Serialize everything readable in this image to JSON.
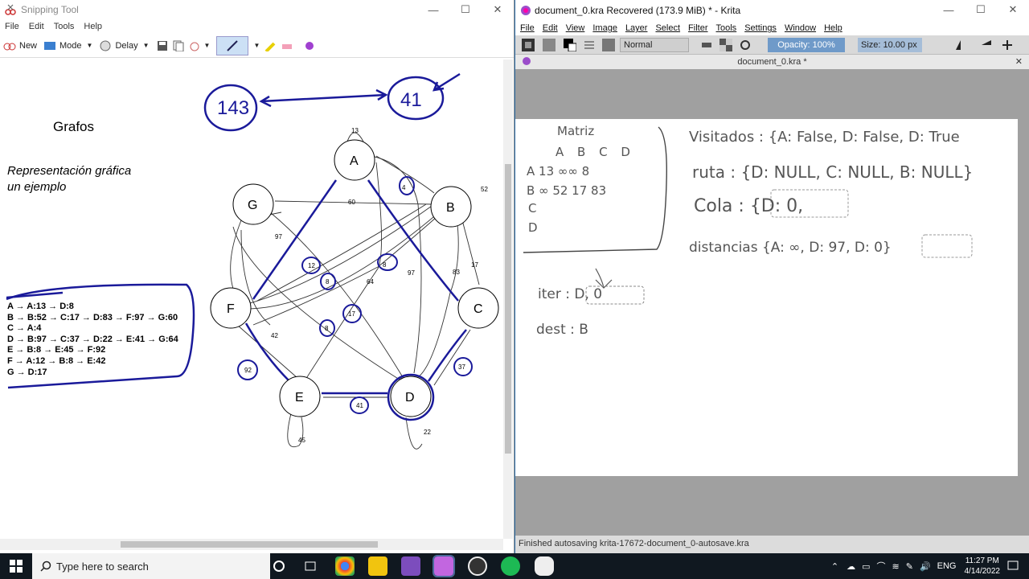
{
  "snip": {
    "title": "Snipping Tool",
    "menu": [
      "File",
      "Edit",
      "Tools",
      "Help"
    ],
    "toolbar": {
      "new": "New",
      "mode": "Mode",
      "delay": "Delay"
    },
    "heading": "Grafos",
    "subtitle1": "Representación gráfica",
    "subtitle2": "un ejemplo",
    "adjacency": [
      "A → A:13 → D:8",
      "B → B:52 → C:17 → D:83 → F:97 → G:60",
      "C → A:4",
      "D → B:97 → C:37 → D:22 → E:41 → G:64",
      "E → B:8 → E:45 → F:92",
      "F → A:12 → B:8 → E:42",
      "G → D:17"
    ],
    "circled_left": "143",
    "circled_right": "41",
    "nodes": [
      "A",
      "B",
      "C",
      "D",
      "E",
      "F",
      "G"
    ],
    "weights": [
      "13",
      "52",
      "60",
      "4",
      "97",
      "17",
      "83",
      "12",
      "8",
      "8",
      "64",
      "97",
      "17",
      "8",
      "42",
      "92",
      "41",
      "37",
      "22",
      "45"
    ]
  },
  "krita": {
    "title": "document_0.kra Recovered  (173.9 MiB)  * - Krita",
    "menu": [
      "File",
      "Edit",
      "View",
      "Image",
      "Layer",
      "Select",
      "Filter",
      "Tools",
      "Settings",
      "Window",
      "Help"
    ],
    "blend_mode": "Normal",
    "opacity": "Opacity: 100%",
    "size": "Size: 10.00 px",
    "tab": "document_0.kra *",
    "status": "Finished autosaving krita-17672-document_0-autosave.kra",
    "notes": {
      "matriz": "Matriz",
      "header": "A  B  C  D",
      "row_a": "A  13  ∞∞  8",
      "row_b": "B  ∞  52  17  83",
      "row_c": "C",
      "row_d": "D",
      "visitados": "Visitados : {A: False, D: False, D: True",
      "ruta": "ruta : {D: NULL, C: NULL, B: NULL}",
      "cola": "Cola : {D: 0,",
      "distancias": "distancias {A: ∞, D: 97, D: 0}",
      "iter": "iter : D, 0",
      "dest": "dest : B"
    }
  },
  "taskbar": {
    "search_placeholder": "Type here to search",
    "lang": "ENG",
    "time": "11:27 PM",
    "date": "4/14/2022"
  }
}
